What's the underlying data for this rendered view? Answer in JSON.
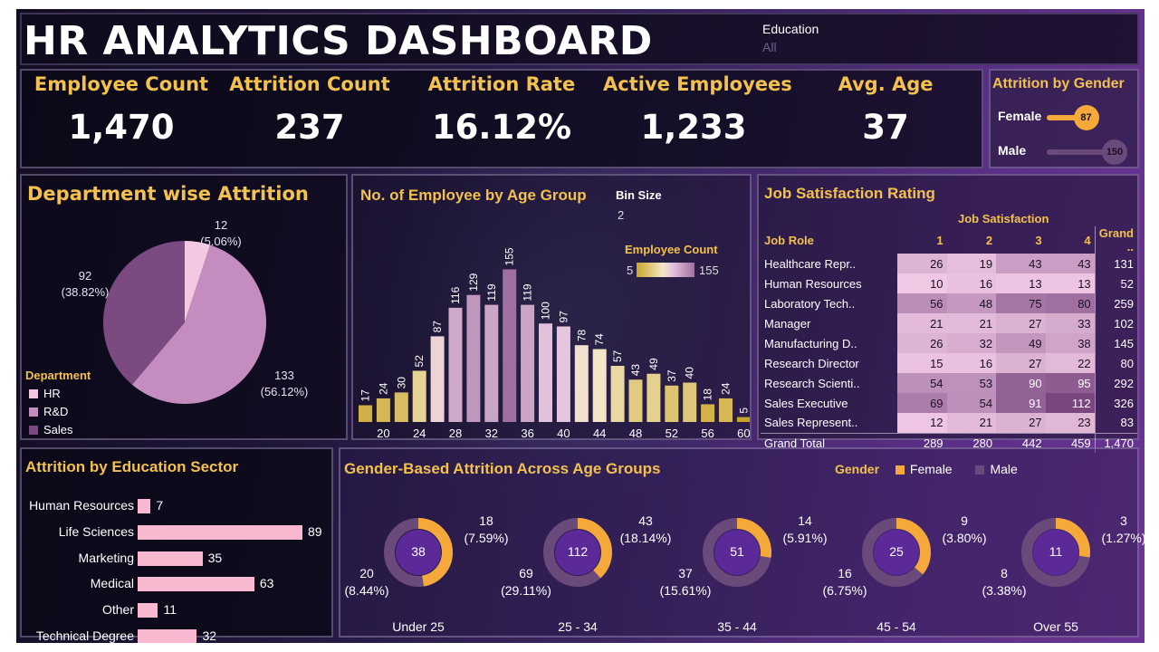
{
  "header": {
    "title": "HR ANALYTICS DASHBOARD",
    "filter_label": "Education",
    "filter_value": "All"
  },
  "kpis": [
    {
      "label": "Employee Count",
      "value": "1,470"
    },
    {
      "label": "Attrition Count",
      "value": "237"
    },
    {
      "label": "Attrition Rate",
      "value": "16.12%"
    },
    {
      "label": "Active Employees",
      "value": "1,233"
    },
    {
      "label": "Avg. Age",
      "value": "37"
    }
  ],
  "gender_attrition": {
    "title": "Attrition by Gender",
    "rows": [
      {
        "label": "Female",
        "value": 87,
        "value_text": "87",
        "color": "#f5a93a"
      },
      {
        "label": "Male",
        "value": 150,
        "value_text": "150",
        "color": "#6a4a7a"
      }
    ]
  },
  "colors": {
    "accent": "#f2c14e",
    "hr": "#f4c8e2",
    "rd": "#c58cbf",
    "sales": "#7a4a80",
    "female": "#f5a93a",
    "male": "#6a4a7a",
    "edu_bar": "#f8b9d0"
  },
  "chart_data": [
    {
      "type": "pie",
      "title": "Department wise Attrition",
      "legend_title": "Department",
      "slices": [
        {
          "name": "HR",
          "value": 12,
          "label": "12",
          "pct": "(5.06%)",
          "color": "#f4c8e2"
        },
        {
          "name": "R&D",
          "value": 133,
          "label": "133",
          "pct": "(56.12%)",
          "color": "#c58cbf"
        },
        {
          "name": "Sales",
          "value": 92,
          "label": "92",
          "pct": "(38.82%)",
          "color": "#7a4a80"
        }
      ]
    },
    {
      "type": "bar",
      "title": "No. of Employee by Age Group",
      "bin_label": "Bin Size",
      "bin_value": "2",
      "legend_title": "Employee Count",
      "legend_min": "5",
      "legend_max": "155",
      "x": [
        18,
        20,
        22,
        24,
        26,
        28,
        30,
        32,
        34,
        36,
        38,
        40,
        42,
        44,
        46,
        48,
        50,
        52,
        54,
        56,
        58,
        60
      ],
      "values": [
        17,
        24,
        30,
        52,
        87,
        116,
        129,
        119,
        155,
        119,
        100,
        97,
        78,
        74,
        57,
        43,
        49,
        37,
        40,
        18,
        24,
        5
      ],
      "tick_labels": [
        "20",
        "24",
        "28",
        "32",
        "36",
        "40",
        "44",
        "48",
        "52",
        "56",
        "60"
      ],
      "ylim": [
        0,
        160
      ]
    },
    {
      "type": "table",
      "title": "Job Satisfaction Rating",
      "column_group": "Job Satisfaction",
      "columns": [
        "Job Role",
        "1",
        "2",
        "3",
        "4",
        "Grand .."
      ],
      "rows": [
        {
          "role": "Healthcare Repr..",
          "values": [
            26,
            19,
            43,
            43
          ],
          "total": "131"
        },
        {
          "role": "Human Resources",
          "values": [
            10,
            16,
            13,
            13
          ],
          "total": "52"
        },
        {
          "role": "Laboratory Tech..",
          "values": [
            56,
            48,
            75,
            80
          ],
          "total": "259"
        },
        {
          "role": "Manager",
          "values": [
            21,
            21,
            27,
            33
          ],
          "total": "102"
        },
        {
          "role": "Manufacturing D..",
          "values": [
            26,
            32,
            49,
            38
          ],
          "total": "145"
        },
        {
          "role": "Research Director",
          "values": [
            15,
            16,
            27,
            22
          ],
          "total": "80"
        },
        {
          "role": "Research Scienti..",
          "values": [
            54,
            53,
            90,
            95
          ],
          "total": "292"
        },
        {
          "role": "Sales Executive",
          "values": [
            69,
            54,
            91,
            112
          ],
          "total": "326"
        },
        {
          "role": "Sales Represent..",
          "values": [
            12,
            21,
            27,
            23
          ],
          "total": "83"
        }
      ],
      "grand_total": {
        "label": "Grand Total",
        "values": [
          "289",
          "280",
          "442",
          "459"
        ],
        "total": "1,470"
      }
    },
    {
      "type": "bar",
      "orientation": "horizontal",
      "title": "Attrition by Education Sector",
      "categories": [
        "Human Resources",
        "Life Sciences",
        "Marketing",
        "Medical",
        "Other",
        "Technical Degree"
      ],
      "values": [
        7,
        89,
        35,
        63,
        11,
        32
      ],
      "value_labels": [
        "7",
        "89",
        "35",
        "63",
        "11",
        "32"
      ]
    },
    {
      "type": "pie",
      "subtype": "donut",
      "title": "Gender-Based Attrition Across Age Groups",
      "legend_title": "Gender",
      "legend": [
        "Female",
        "Male"
      ],
      "groups": [
        {
          "category": "Under 25",
          "total": 38,
          "total_text": "38",
          "female": 18,
          "female_label": "18",
          "female_pct": "(7.59%)",
          "male": 20,
          "male_label": "20",
          "male_pct": "(8.44%)"
        },
        {
          "category": "25 - 34",
          "total": 112,
          "total_text": "112",
          "female": 43,
          "female_label": "43",
          "female_pct": "(18.14%)",
          "male": 69,
          "male_label": "69",
          "male_pct": "(29.11%)"
        },
        {
          "category": "35 - 44",
          "total": 51,
          "total_text": "51",
          "female": 14,
          "female_label": "14",
          "female_pct": "(5.91%)",
          "male": 37,
          "male_label": "37",
          "male_pct": "(15.61%)"
        },
        {
          "category": "45 - 54",
          "total": 25,
          "total_text": "25",
          "female": 9,
          "female_label": "9",
          "female_pct": "(3.80%)",
          "male": 16,
          "male_label": "16",
          "male_pct": "(6.75%)"
        },
        {
          "category": "Over 55",
          "total": 11,
          "total_text": "11",
          "female": 3,
          "female_label": "3",
          "female_pct": "(1.27%)",
          "male": 8,
          "male_label": "8",
          "male_pct": "(3.38%)"
        }
      ]
    }
  ]
}
